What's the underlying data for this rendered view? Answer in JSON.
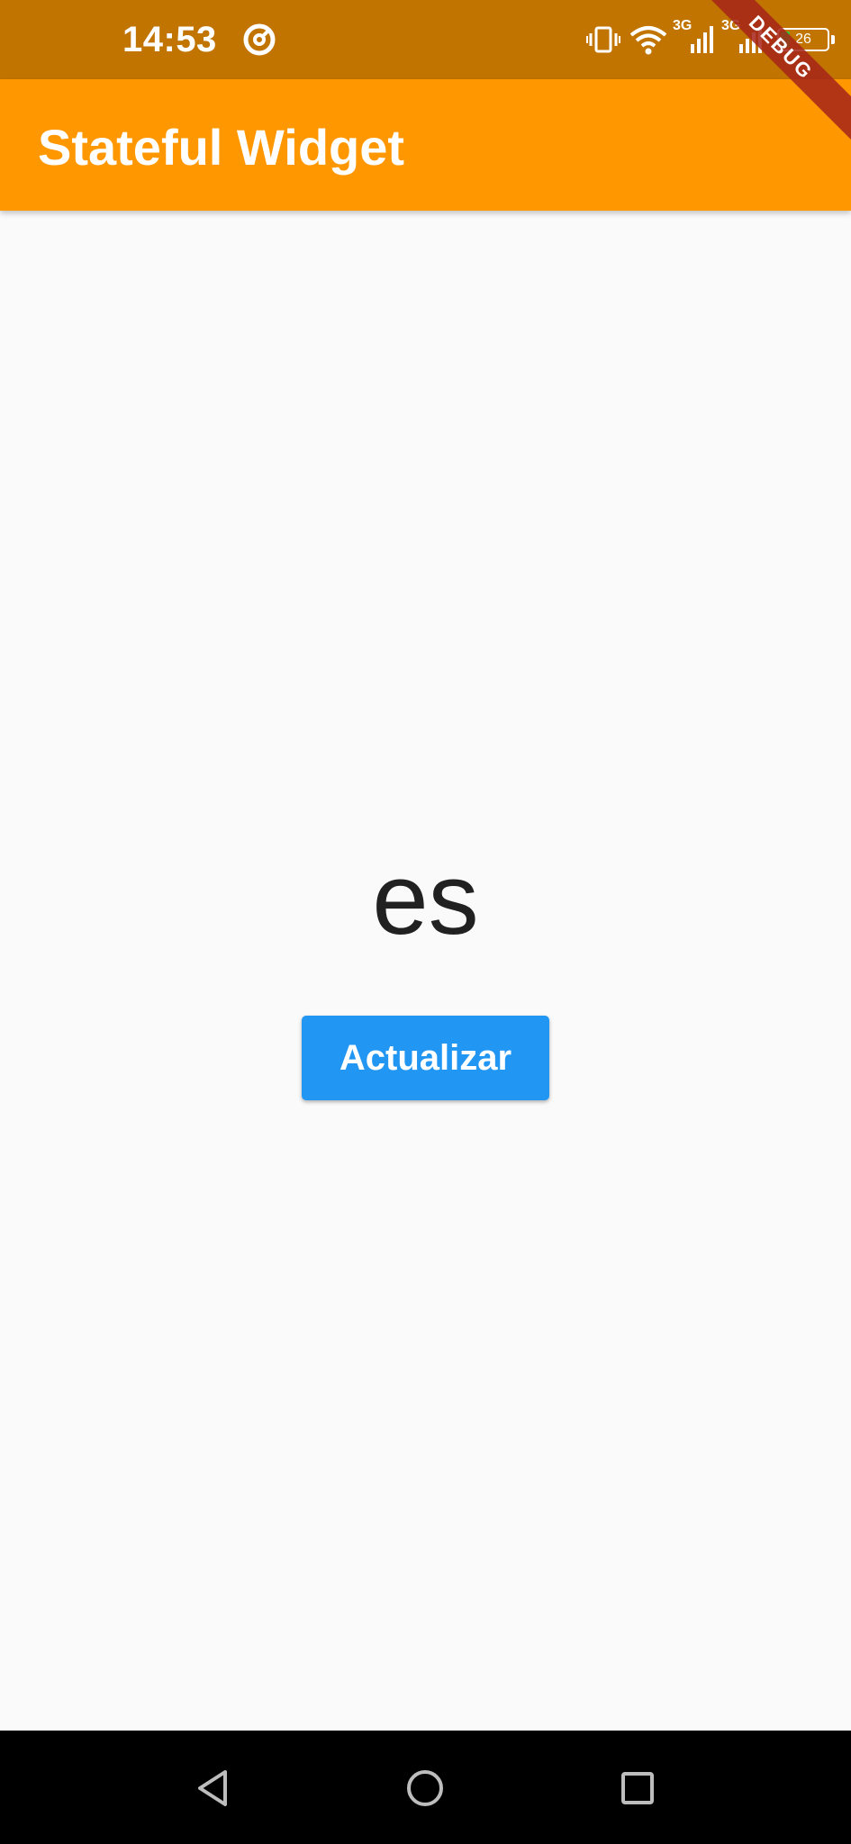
{
  "status_bar": {
    "time": "14:53",
    "network_labels": [
      "3G",
      "3G"
    ],
    "battery_level": "26",
    "battery_fraction": 0.26,
    "icons": [
      "app-notification-icon",
      "vibrate-icon",
      "wifi-icon",
      "signal-icon",
      "signal-icon",
      "battery-icon"
    ],
    "background_color": "#c27400"
  },
  "app_bar": {
    "title": "Stateful Widget",
    "background_color": "#ff9800"
  },
  "debug_banner": {
    "label": "DEBUG"
  },
  "main": {
    "value_text": "es",
    "button_label": "Actualizar",
    "button_color": "#2196f3"
  },
  "nav_bar": {
    "icons": [
      "back-icon",
      "home-icon",
      "recents-icon"
    ]
  }
}
